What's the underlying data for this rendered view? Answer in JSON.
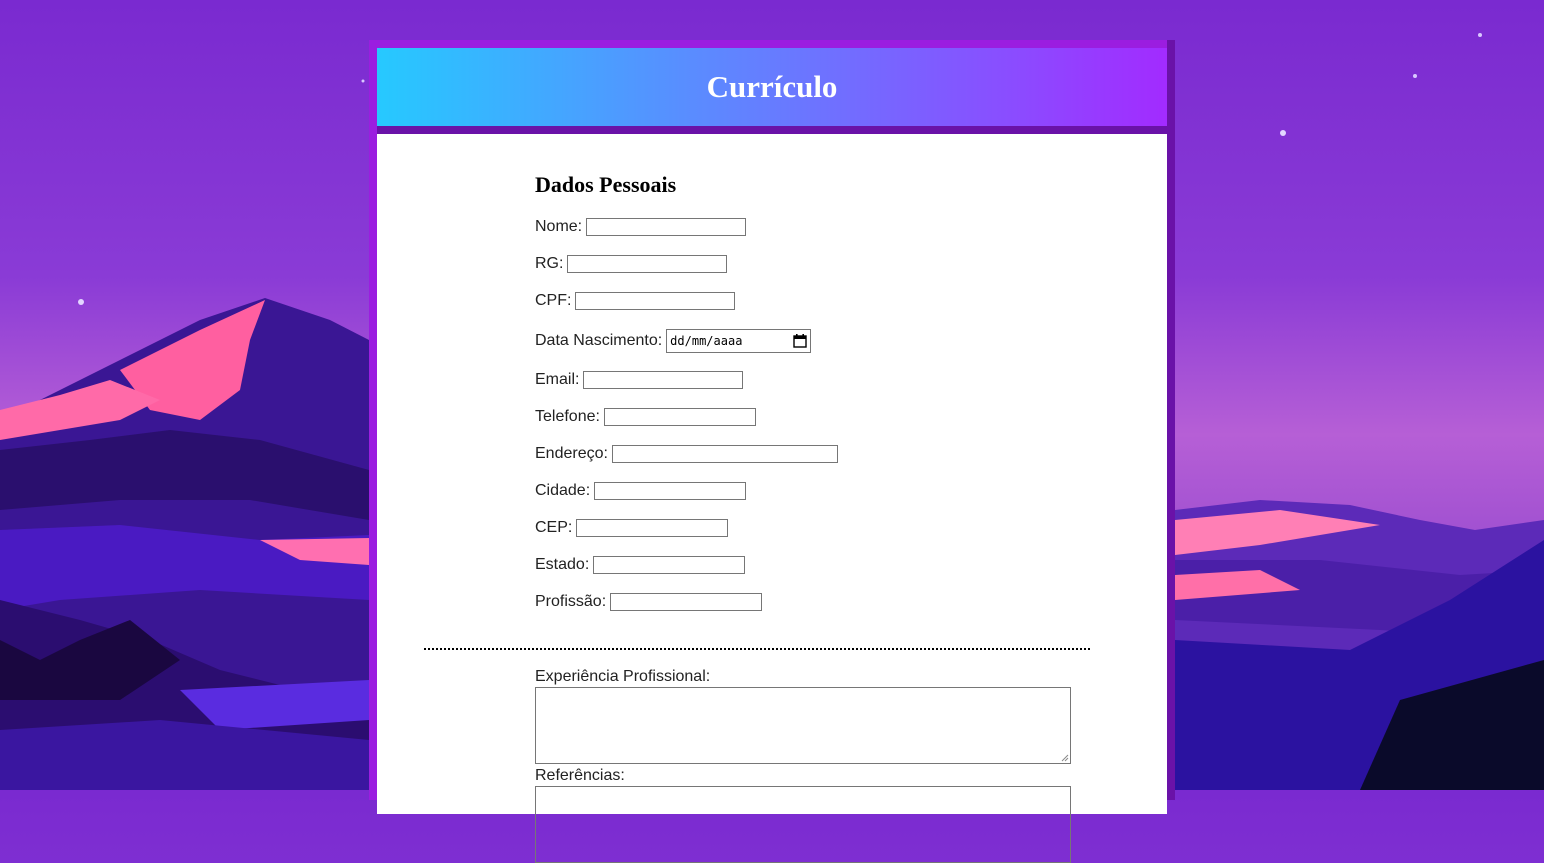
{
  "header": {
    "title": "Currículo"
  },
  "section": {
    "title": "Dados Pessoais"
  },
  "fields": {
    "nome": "Nome:",
    "rg": "RG:",
    "cpf": "CPF:",
    "data_nascimento": "Data Nascimento:",
    "date_placeholder": "dd/mm/aaaa",
    "email": "Email:",
    "telefone": "Telefone:",
    "endereco": "Endereço:",
    "cidade": "Cidade:",
    "cep": "CEP:",
    "estado": "Estado:",
    "profissao": "Profissão:"
  },
  "textareas": {
    "experiencia": "Experiência Profissional:",
    "referencias": "Referências:"
  },
  "colors": {
    "header_start": "#26c9ff",
    "header_end": "#a22bff",
    "frame": "#9b1de0"
  }
}
